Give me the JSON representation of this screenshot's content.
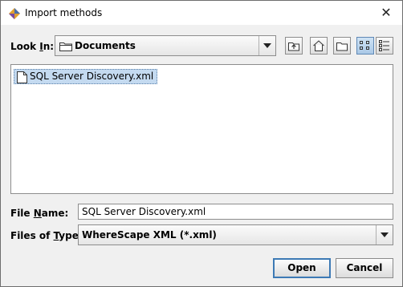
{
  "window": {
    "title": "Import methods",
    "close_glyph": "✕"
  },
  "look_in": {
    "label_pre": "Look ",
    "label_mnemonic": "I",
    "label_post": "n:",
    "value": "Documents"
  },
  "toolbar": {
    "buttons": [
      {
        "name": "up-one-level-icon"
      },
      {
        "name": "home-icon"
      },
      {
        "name": "new-folder-icon"
      },
      {
        "name": "list-view-icon",
        "selected": true
      },
      {
        "name": "details-view-icon"
      }
    ]
  },
  "files": [
    {
      "name": "SQL Server Discovery.xml",
      "selected": true
    }
  ],
  "file_name": {
    "label_pre": "File ",
    "label_mnemonic": "N",
    "label_post": "ame:",
    "value": "SQL Server Discovery.xml"
  },
  "file_type": {
    "label_pre": "Files of ",
    "label_mnemonic": "T",
    "label_post": "ype:",
    "value": "WhereScape XML (*.xml)"
  },
  "buttons": {
    "open": "Open",
    "cancel": "Cancel"
  },
  "colors": {
    "selection": "#c4daf0",
    "default_button_border": "#3d7ab5"
  }
}
